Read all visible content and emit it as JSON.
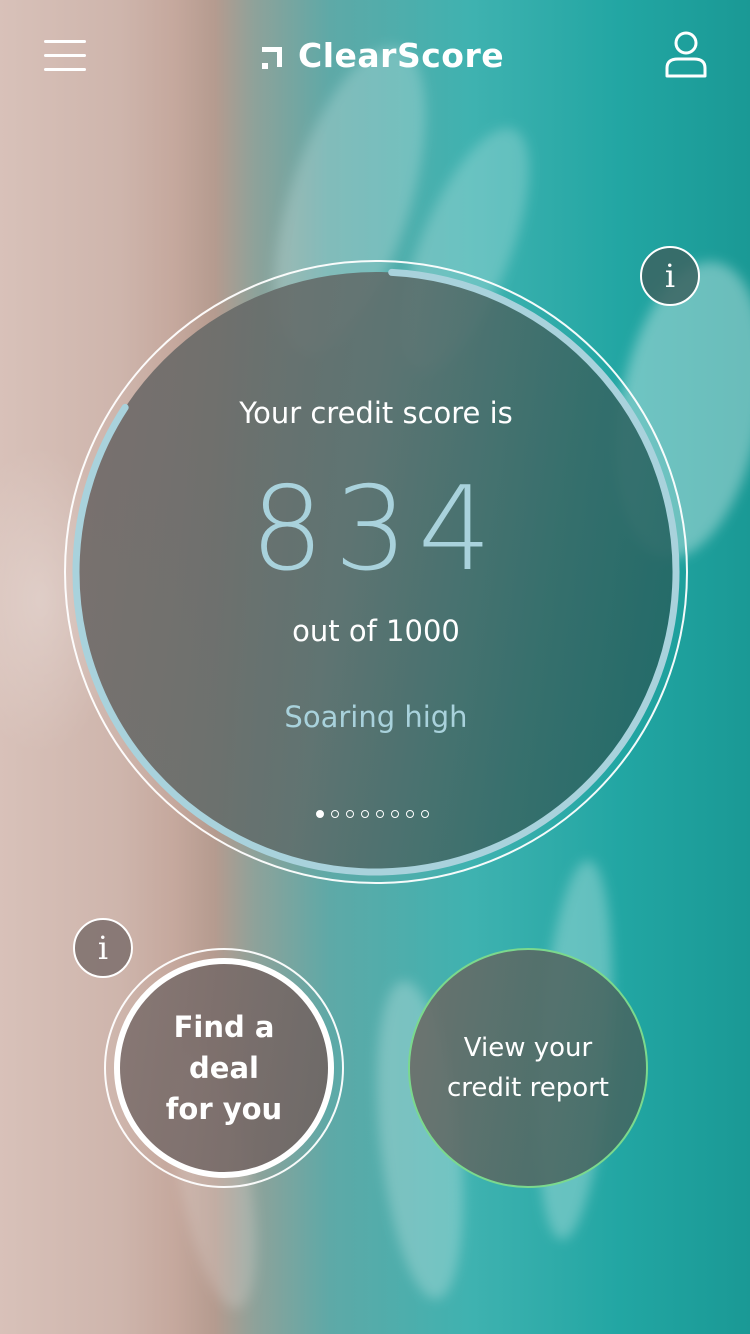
{
  "header": {
    "menu_icon": "hamburger-menu-icon",
    "logo_text": "ClearScore",
    "profile_icon": "user-profile-icon"
  },
  "score": {
    "heading": "Your credit score is",
    "value": "834",
    "out_of": "out of 1000",
    "status": "Soaring high",
    "fraction": 0.834,
    "ring_color": "#a9d2dc"
  },
  "pager": {
    "count": 8,
    "active": 0
  },
  "info": {
    "glyph": "i"
  },
  "actions": {
    "deal_label_line1": "Find a deal",
    "deal_label_line2": "for you",
    "report_label_line1": "View your",
    "report_label_line2": "credit report",
    "report_border_color": "#7bd98d"
  }
}
